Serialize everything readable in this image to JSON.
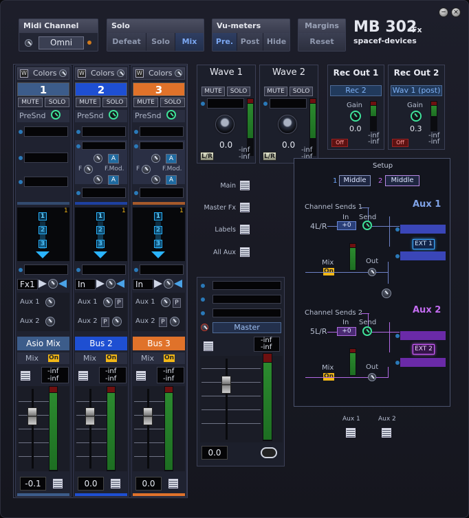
{
  "window": {
    "minimize_glyph": "−",
    "close_glyph": "×"
  },
  "midi": {
    "title": "Midi Channel",
    "value": "Omni"
  },
  "solo_group": {
    "title": "Solo",
    "buttons": [
      "Defeat",
      "Solo",
      "Mix"
    ],
    "active": "Mix"
  },
  "vu_group": {
    "title": "Vu-meters",
    "buttons": [
      "Pre.",
      "Post",
      "Hide"
    ],
    "active": "Pre."
  },
  "margins_group": {
    "title": "Margins",
    "button": "Reset"
  },
  "logo": {
    "name": "MB 302",
    "fx": "Fx",
    "vendor": "spacef-devices"
  },
  "channels": [
    {
      "colors_label": "Colors",
      "w_label": "W",
      "number": "1",
      "number_color": "#3c5c8a",
      "mute": "MUTE",
      "solo": "SOLO",
      "presnd": "PreSnd",
      "send_value": "1",
      "stack": [
        "1",
        "2",
        "3"
      ],
      "input": "Fx1",
      "aux1": "Aux 1",
      "aux2": "Aux 2",
      "bus_name": "Asio Mix",
      "bus_color": "#3c5c8a",
      "mix": "Mix",
      "on": "On",
      "meter_top": "-inf",
      "meter_bottom": "-inf",
      "level": "-0.1",
      "bottom_color": "#3c5c8a"
    },
    {
      "colors_label": "Colors",
      "w_label": "W",
      "number": "2",
      "number_color": "#1e4fd2",
      "mute": "MUTE",
      "solo": "SOLO",
      "presnd": "PreSnd",
      "fmod_label": "F.Mod.",
      "f_label": "F",
      "a_label": "A",
      "send_value": "1",
      "stack": [
        "1",
        "2",
        "3"
      ],
      "input": "In",
      "aux1": "Aux 1",
      "aux2": "Aux 2",
      "p_label": "P",
      "bus_name": "Bus 2",
      "bus_color": "#1e4fd2",
      "mix": "Mix",
      "on": "On",
      "meter_top": "-inf",
      "meter_bottom": "-inf",
      "level": "0.0",
      "bottom_color": "#1e4fd2"
    },
    {
      "colors_label": "Colors",
      "w_label": "W",
      "number": "3",
      "number_color": "#e0722a",
      "mute": "MUTE",
      "solo": "SOLO",
      "presnd": "PreSnd",
      "fmod_label": "F.Mod.",
      "f_label": "F",
      "a_label": "A",
      "send_value": "1",
      "stack": [
        "1",
        "2",
        "3"
      ],
      "input": "In",
      "aux1": "Aux 1",
      "aux2": "Aux 2",
      "p_label": "P",
      "bus_name": "Bus 3",
      "bus_color": "#e0722a",
      "mix": "Mix",
      "on": "On",
      "meter_top": "-inf",
      "meter_bottom": "-inf",
      "level": "0.0",
      "bottom_color": "#e0722a"
    }
  ],
  "waves": [
    {
      "title": "Wave 1",
      "mute": "MUTE",
      "solo": "SOLO",
      "value": "0.0",
      "meter_top": "-inf",
      "meter_bottom": "-inf",
      "lr": "L/R"
    },
    {
      "title": "Wave 2",
      "mute": "MUTE",
      "solo": "SOLO",
      "value": "0.0",
      "meter_top": "-inf",
      "meter_bottom": "-inf",
      "lr": "L/R"
    }
  ],
  "rec_outs": [
    {
      "title": "Rec Out 1",
      "source": "Rec 2",
      "gain_label": "Gain",
      "gain": "0.0",
      "meter_top": "-inf",
      "meter_bottom": "-inf",
      "off": "Off"
    },
    {
      "title": "Rec Out 2",
      "source": "Wav 1 (post)",
      "gain_label": "Gain",
      "gain": "0.3",
      "meter_top": "-inf",
      "meter_bottom": "-inf",
      "off": "Off"
    }
  ],
  "side_links": [
    "Main",
    "Master Fx",
    "Labels",
    "All Aux"
  ],
  "master": {
    "label": "Master",
    "meter_top": "-inf",
    "meter_bottom": "-inf",
    "level": "0.0"
  },
  "setup": {
    "title": "Setup",
    "sel1_index": "1",
    "sel1_value": "Middle",
    "sel2_index": "2",
    "sel2_value": "Middle",
    "aux1_label": "Aux 1",
    "aux2_label": "Aux 2",
    "ch_sends_1": "Channel Sends 1",
    "ch_sends_2": "Channel Sends 2",
    "in_label": "In",
    "send_label": "Send",
    "input1": "4L/R",
    "input2": "5L/R",
    "plus0": "+0",
    "mix_label": "Mix",
    "on": "On",
    "out_label": "Out",
    "ext1": "EXT 1",
    "ext2": "EXT 2"
  },
  "bottom_aux": [
    "Aux 1",
    "Aux 2"
  ],
  "colors": {
    "accent_blue": "#3a78d8",
    "led_green": "#3fe29a",
    "on_yellow": "#f2b716",
    "aux1_cyan": "#6fa8ff",
    "aux2_purple": "#c36cf0"
  }
}
